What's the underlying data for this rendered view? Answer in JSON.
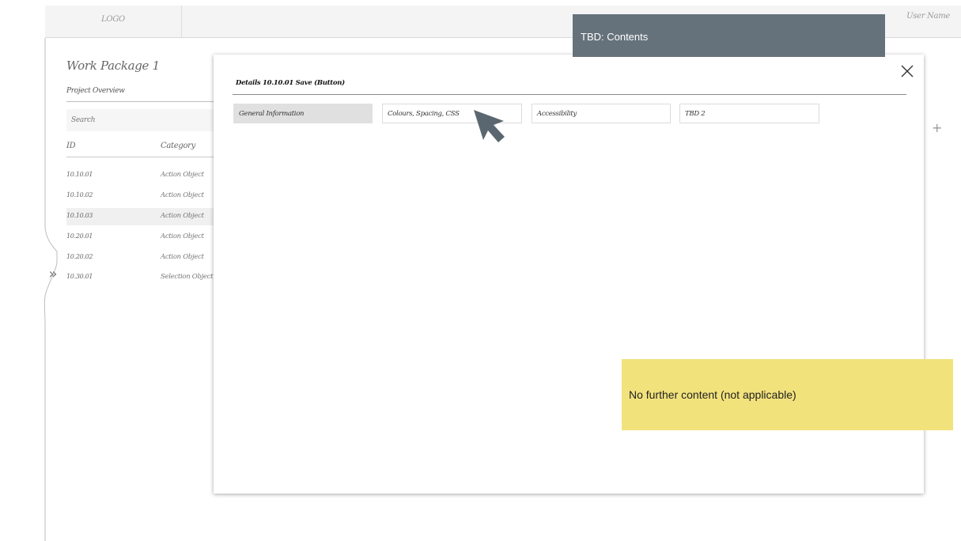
{
  "header": {
    "logo": "LOGO",
    "user_name": "User Name"
  },
  "side_panel": {
    "title": "Work Package 1",
    "tab": "Project Overview",
    "search_placeholder": "Search",
    "columns": {
      "id": "ID",
      "category": "Category"
    },
    "rows": [
      {
        "id": "10.10.01",
        "category": "Action Object"
      },
      {
        "id": "10.10.02",
        "category": "Action Object"
      },
      {
        "id": "10.10.03",
        "category": "Action Object"
      },
      {
        "id": "10.20.01",
        "category": "Action Object"
      },
      {
        "id": "10.20.02",
        "category": "Action Object"
      },
      {
        "id": "10.30.01",
        "category": "Selection Object"
      }
    ]
  },
  "modal": {
    "title": "Details 10.10.01 Save (Button)",
    "tabs": [
      "General Information",
      "Colours, Spacing, CSS",
      "Accessibility",
      "TBD 2"
    ],
    "close_icon": "close-icon"
  },
  "annotations": {
    "contents": "TBD: Contents",
    "not_applicable": "No further content (not applicable)"
  },
  "icons": {
    "expand": "double-chevron-right-icon",
    "add": "plus-icon",
    "cursor": "cursor-arrow-icon"
  },
  "colors": {
    "note_dark": "#66727b",
    "note_yellow": "#f2e27c",
    "cursor": "#5b6770"
  }
}
